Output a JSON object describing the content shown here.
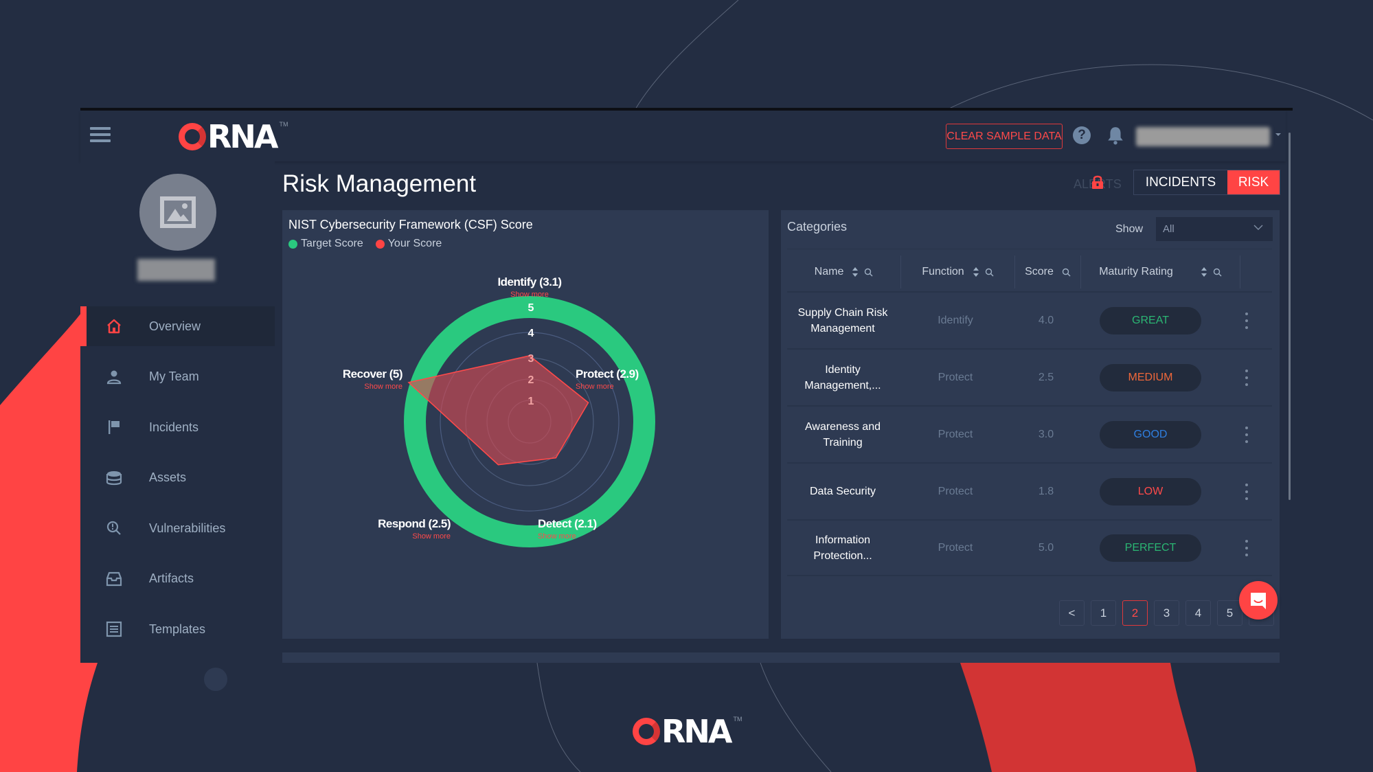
{
  "app": {
    "brand": "RNA",
    "trademark": "TM"
  },
  "header": {
    "clear_sample_data_label": "CLEAR SAMPLE DATA",
    "help_icon": "question-circle",
    "notifications_icon": "bell"
  },
  "sidebar": {
    "items": [
      {
        "label": "Overview",
        "icon": "home",
        "active": true
      },
      {
        "label": "My Team",
        "icon": "user"
      },
      {
        "label": "Incidents",
        "icon": "flag"
      },
      {
        "label": "Assets",
        "icon": "database"
      },
      {
        "label": "Vulnerabilities",
        "icon": "search-alert"
      },
      {
        "label": "Artifacts",
        "icon": "inbox"
      },
      {
        "label": "Templates",
        "icon": "list-box"
      }
    ]
  },
  "page": {
    "title": "Risk Management",
    "tabs": {
      "alerts": "ALERTS",
      "incidents": "INCIDENTS",
      "risk": "RISK"
    }
  },
  "colors": {
    "accent": "#ff4444",
    "target": "#2ac97f",
    "great": "#2bb673",
    "medium": "#f0683a",
    "good": "#2f7fe0",
    "low": "#ff4a4a",
    "perfect": "#2bb673"
  },
  "chart_data": {
    "type": "radar",
    "title": "NIST Cybersecurity Framework (CSF) Score",
    "legend": [
      {
        "name": "Target Score",
        "color": "#2ac97f"
      },
      {
        "name": "Your Score",
        "color": "#ff4444"
      }
    ],
    "legend_position": "top-left",
    "axes": [
      "Identify",
      "Protect",
      "Detect",
      "Respond",
      "Recover"
    ],
    "axis_labels": [
      "Identify (3.1)",
      "Protect (2.9)",
      "Detect (2.1)",
      "Respond (2.5)",
      "Recover (5)"
    ],
    "show_more_label": "Show more",
    "scale_ticks": [
      "1",
      "2",
      "3",
      "4",
      "5"
    ],
    "range": [
      0,
      5
    ],
    "series": [
      {
        "name": "Target Score",
        "values": [
          5,
          5,
          5,
          5,
          5
        ]
      },
      {
        "name": "Your Score",
        "values": [
          3.1,
          2.9,
          2.1,
          2.5,
          5
        ]
      }
    ]
  },
  "categories": {
    "title": "Categories",
    "show_label": "Show",
    "show_value": "All",
    "columns": [
      "Name",
      "Function",
      "Score",
      "Maturity Rating"
    ],
    "rows": [
      {
        "name": "Supply Chain Risk Management",
        "function": "Identify",
        "score": "4.0",
        "rating": "GREAT",
        "rating_key": "great"
      },
      {
        "name": "Identity Management,...",
        "function": "Protect",
        "score": "2.5",
        "rating": "MEDIUM",
        "rating_key": "medium"
      },
      {
        "name": "Awareness and Training",
        "function": "Protect",
        "score": "3.0",
        "rating": "GOOD",
        "rating_key": "good"
      },
      {
        "name": "Data Security",
        "function": "Protect",
        "score": "1.8",
        "rating": "LOW",
        "rating_key": "low"
      },
      {
        "name": "Information Protection...",
        "function": "Protect",
        "score": "5.0",
        "rating": "PERFECT",
        "rating_key": "perfect"
      }
    ],
    "pagination": {
      "prev": "<",
      "pages": [
        "1",
        "2",
        "3",
        "4",
        "5"
      ],
      "current": "2",
      "next": ">"
    }
  }
}
